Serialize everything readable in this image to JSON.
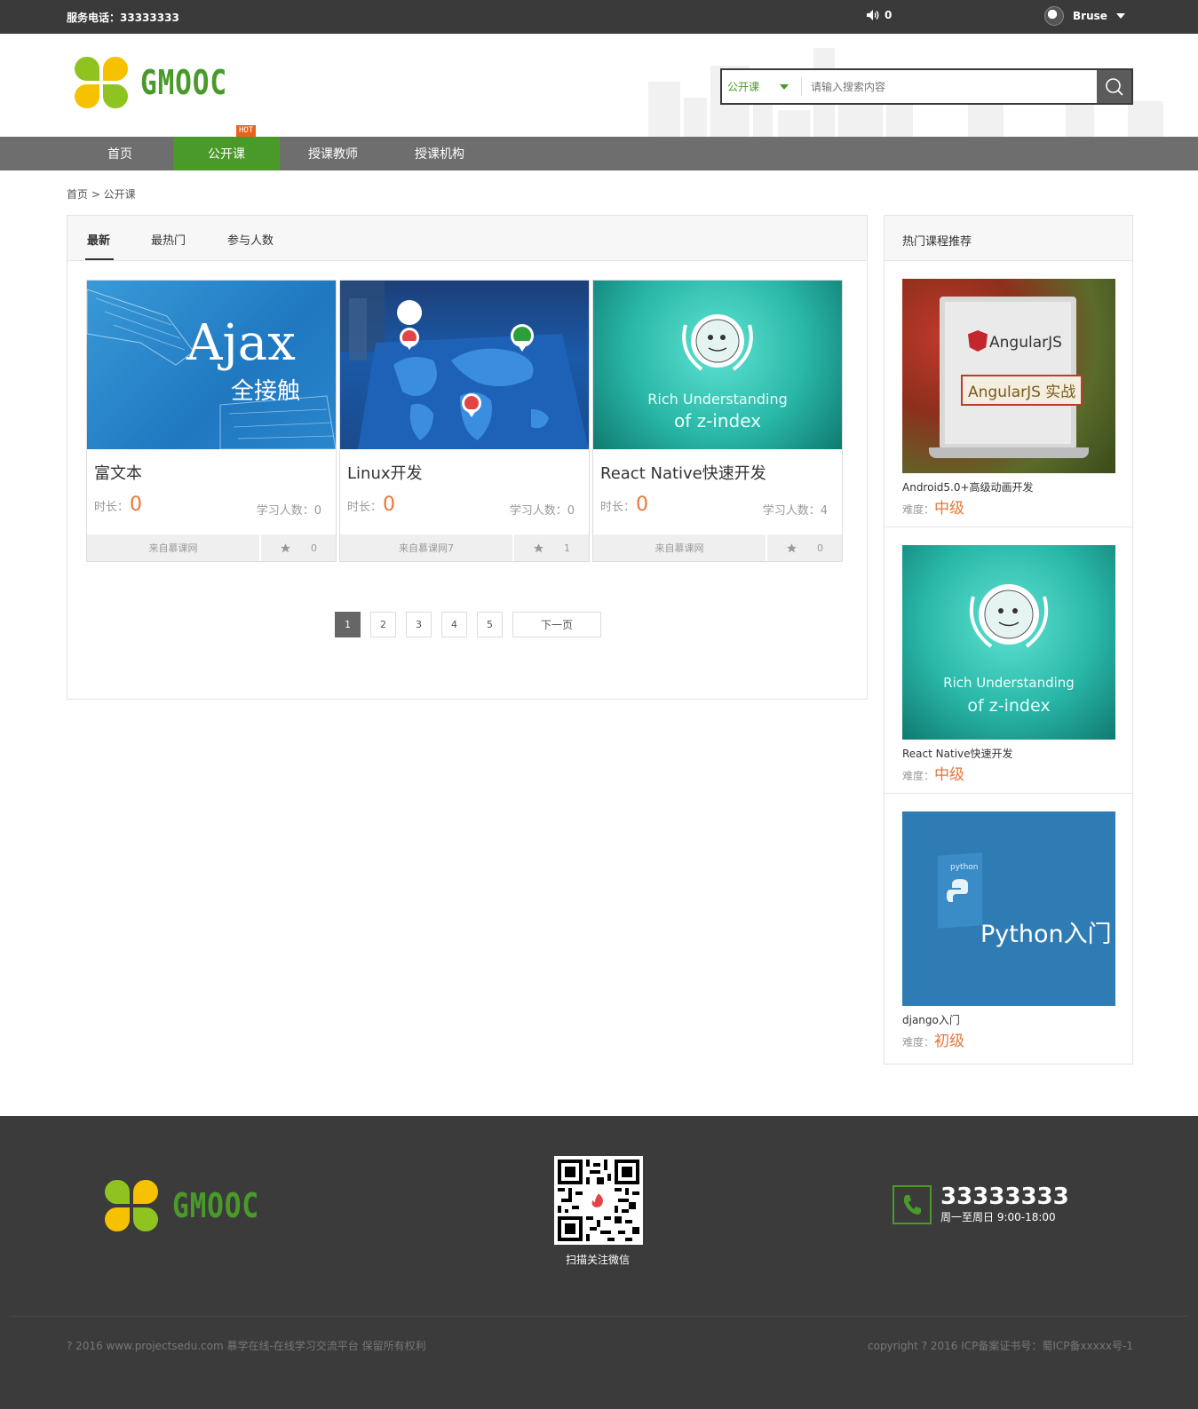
{
  "topbar": {
    "phone": "服务电话：33333333",
    "msg_count": "0",
    "username": "Bruse"
  },
  "header": {
    "logo_text": "GMOOC",
    "search": {
      "type": "公开课",
      "placeholder": "请输入搜索内容"
    }
  },
  "nav": {
    "items": [
      {
        "label": "首页"
      },
      {
        "label": "公开课"
      },
      {
        "label": "授课教师"
      },
      {
        "label": "授课机构"
      }
    ],
    "hot_badge": "HOT"
  },
  "breadcrumb": "首页 > 公开课",
  "tabs": [
    {
      "label": "最新"
    },
    {
      "label": "最热门"
    },
    {
      "label": "参与人数"
    }
  ],
  "courses": [
    {
      "image": "Ajax",
      "image_sub": "全接触",
      "title": "富文本",
      "duration_label": "时长：",
      "duration": "0",
      "learners": "学习人数：0",
      "org": "来自慕课网",
      "favs": "0"
    },
    {
      "image": "world-map",
      "title": "Linux开发",
      "duration_label": "时长：",
      "duration": "0",
      "learners": "学习人数：0",
      "org": "来自慕课网7",
      "favs": "1"
    },
    {
      "image": "Rich Understanding",
      "image_sub": "of z-index",
      "title": "React Native快速开发",
      "duration_label": "时长：",
      "duration": "0",
      "learners": "学习人数：4",
      "org": "来自慕课网",
      "favs": "0"
    }
  ],
  "pagination": {
    "pages": [
      "1",
      "2",
      "3",
      "4",
      "5"
    ],
    "current": "1",
    "next": "下一页"
  },
  "sidebar": {
    "title": "热门课程推荐",
    "items": [
      {
        "image": "AngularJS",
        "image_sub": "AngularJS 实战",
        "name": "Android5.0+高级动画开发",
        "level_label": "难度：",
        "level": "中级"
      },
      {
        "image": "Rich Understanding",
        "image_sub": "of z-index",
        "name": "React Native快速开发",
        "level_label": "难度：",
        "level": "中级"
      },
      {
        "image": "Python入门",
        "image_sub": "python",
        "name": "django入门",
        "level_label": "难度：",
        "level": "初级"
      }
    ]
  },
  "footer": {
    "logo_text": "GMOOC",
    "qr_label": "扫描关注微信",
    "phone": "33333333",
    "hours": "周一至周日 9:00-18:00",
    "copyright_left": "? 2016 www.projectsedu.com 慕学在线-在线学习交流平台 保留所有权利",
    "copyright_right": "copyright ? 2016 ICP备案证书号：蜀ICP备xxxxx号-1"
  },
  "colors": {
    "brand_green": "#4a9a2a",
    "accent_orange": "#e8763a",
    "topbar_bg": "#3a3a3a",
    "nav_bg": "#6e6e6e"
  }
}
